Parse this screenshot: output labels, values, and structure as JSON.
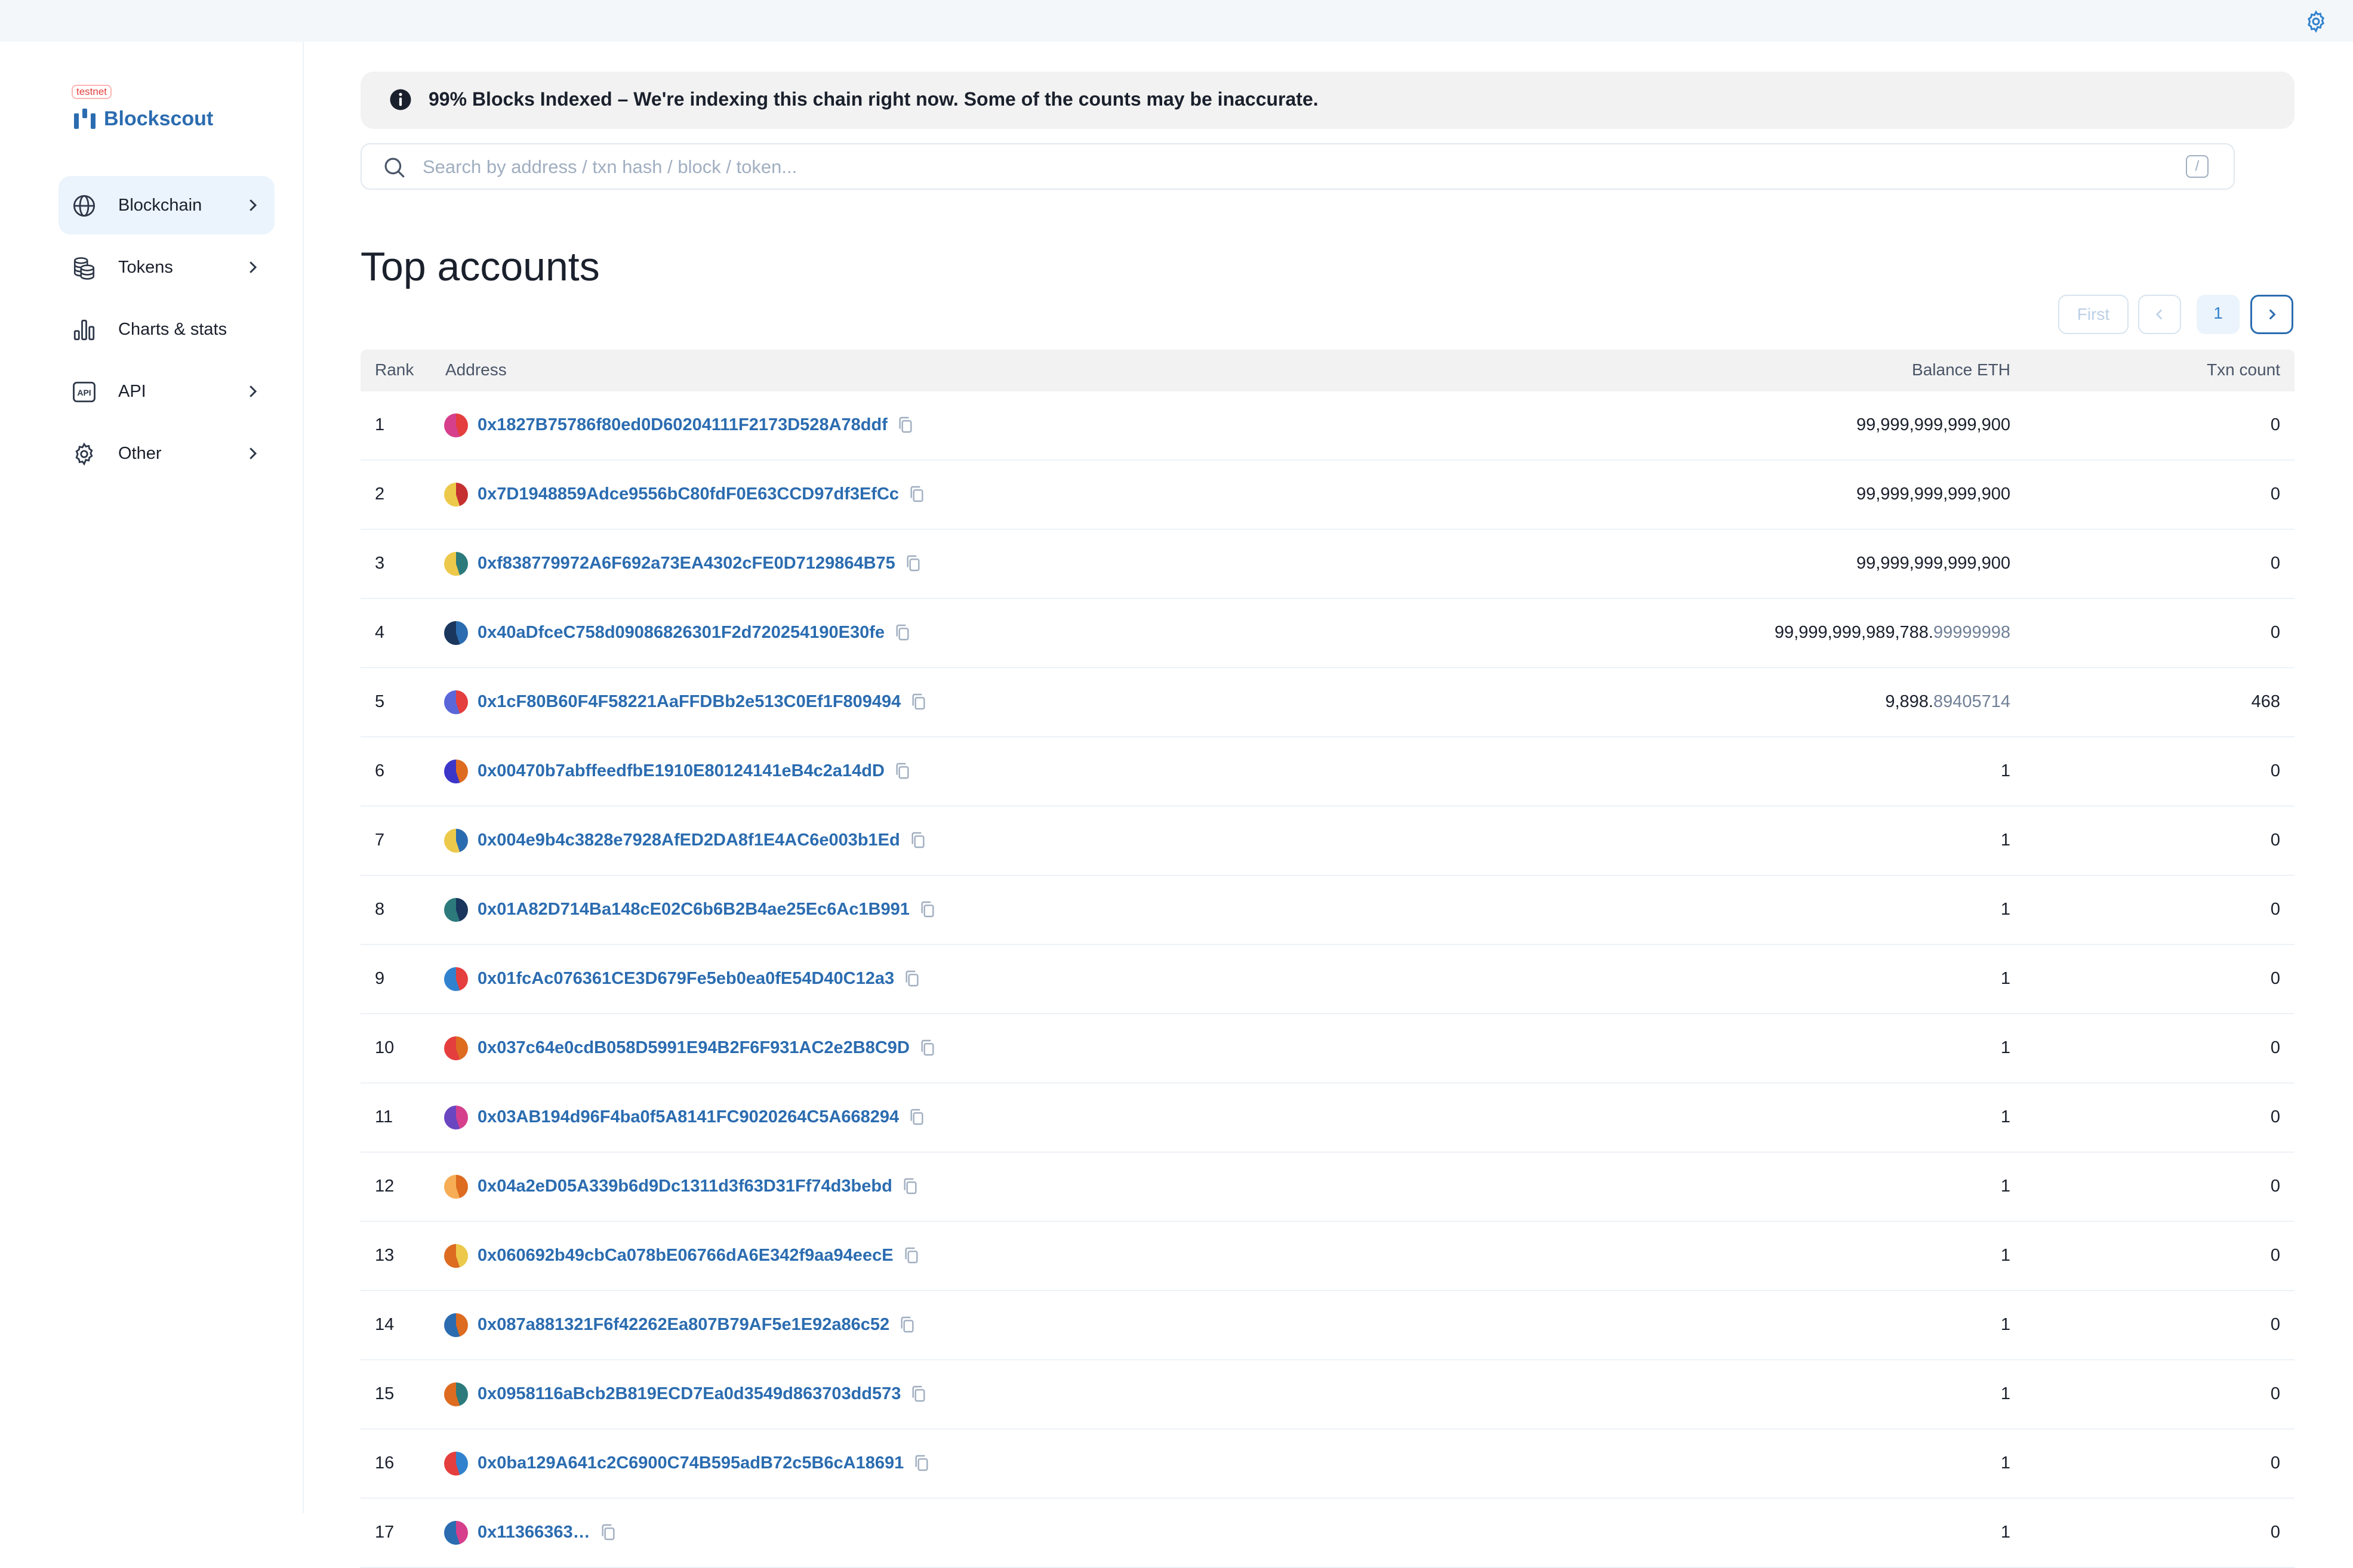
{
  "topbar": {
    "settings_icon": "gear-icon"
  },
  "sidebar": {
    "badge": "testnet",
    "brand": "Blockscout",
    "items": [
      {
        "label": "Blockchain",
        "icon": "globe-icon",
        "active": true,
        "has_submenu": true
      },
      {
        "label": "Tokens",
        "icon": "coins-icon",
        "active": false,
        "has_submenu": true
      },
      {
        "label": "Charts & stats",
        "icon": "bar-chart-icon",
        "active": false,
        "has_submenu": false
      },
      {
        "label": "API",
        "icon": "api-icon",
        "active": false,
        "has_submenu": true
      },
      {
        "label": "Other",
        "icon": "gear-icon",
        "active": false,
        "has_submenu": true
      }
    ]
  },
  "banner": {
    "icon": "info-icon",
    "text": "99% Blocks Indexed – We're indexing this chain right now. Some of the counts may be inaccurate."
  },
  "search": {
    "placeholder": "Search by address / txn hash / block / token...",
    "value": "",
    "shortcut": "/"
  },
  "page": {
    "title": "Top accounts"
  },
  "pagination": {
    "first": "First",
    "current": "1"
  },
  "table": {
    "columns": {
      "rank": "Rank",
      "address": "Address",
      "balance": "Balance ETH",
      "txn": "Txn count"
    },
    "rows": [
      {
        "rank": "1",
        "address": "0x1827B75786f80ed0D60204111F2173D528A78ddf",
        "balance_int": "99,999,999,999,900",
        "balance_frac": "",
        "txn": "0",
        "colors": [
          "#e53e3e",
          "#d53f8c"
        ]
      },
      {
        "rank": "2",
        "address": "0x7D1948859Adce9556bC80fdF0E63CCD97df3EfCc",
        "balance_int": "99,999,999,999,900",
        "balance_frac": "",
        "txn": "0",
        "colors": [
          "#c53030",
          "#ecc94b"
        ]
      },
      {
        "rank": "3",
        "address": "0xf838779972A6F692a73EA4302cFE0D7129864B75",
        "balance_int": "99,999,999,999,900",
        "balance_frac": "",
        "txn": "0",
        "colors": [
          "#2c7a7b",
          "#ecc94b"
        ]
      },
      {
        "rank": "4",
        "address": "0x40aDfceC758d09086826301F2d720254190E30fe",
        "balance_int": "99,999,999,989,788.",
        "balance_frac": "99999998",
        "txn": "0",
        "colors": [
          "#2b6cb0",
          "#1a365d"
        ]
      },
      {
        "rank": "5",
        "address": "0x1cF80B60F4F58221AaFFDBb2e513C0Ef1F809494",
        "balance_int": "9,898.",
        "balance_frac": "89405714",
        "txn": "468",
        "colors": [
          "#e53e3e",
          "#5a67d8"
        ]
      },
      {
        "rank": "6",
        "address": "0x00470b7abffeedfbE1910E80124141eB4c2a14dD",
        "balance_int": "1",
        "balance_frac": "",
        "txn": "0",
        "colors": [
          "#dd6b20",
          "#3c36c8"
        ]
      },
      {
        "rank": "7",
        "address": "0x004e9b4c3828e7928AfED2DA8f1E4AC6e003b1Ed",
        "balance_int": "1",
        "balance_frac": "",
        "txn": "0",
        "colors": [
          "#2b6cb0",
          "#ecc94b"
        ]
      },
      {
        "rank": "8",
        "address": "0x01A82D714Ba148cE02C6b6B2B4ae25Ec6Ac1B991",
        "balance_int": "1",
        "balance_frac": "",
        "txn": "0",
        "colors": [
          "#1a365d",
          "#2c7a7b"
        ]
      },
      {
        "rank": "9",
        "address": "0x01fcAc076361CE3D679Fe5eb0ea0fE54D40C12a3",
        "balance_int": "1",
        "balance_frac": "",
        "txn": "0",
        "colors": [
          "#e53e3e",
          "#3182ce"
        ]
      },
      {
        "rank": "10",
        "address": "0x037c64e0cdB058D5991E94B2F6F931AC2e2B8C9D",
        "balance_int": "1",
        "balance_frac": "",
        "txn": "0",
        "colors": [
          "#dd6b20",
          "#e53e3e"
        ]
      },
      {
        "rank": "11",
        "address": "0x03AB194d96F4ba0f5A8141FC9020264C5A668294",
        "balance_int": "1",
        "balance_frac": "",
        "txn": "0",
        "colors": [
          "#d53f8c",
          "#6b46c1"
        ]
      },
      {
        "rank": "12",
        "address": "0x04a2eD05A339b6d9Dc1311d3f63D31Ff74d3bebd",
        "balance_int": "1",
        "balance_frac": "",
        "txn": "0",
        "colors": [
          "#dd6b20",
          "#f6ad55"
        ]
      },
      {
        "rank": "13",
        "address": "0x060692b49cbCa078bE06766dA6E342f9aa94eecE",
        "balance_int": "1",
        "balance_frac": "",
        "txn": "0",
        "colors": [
          "#ecc94b",
          "#dd6b20"
        ]
      },
      {
        "rank": "14",
        "address": "0x087a881321F6f42262Ea807B79AF5e1E92a86c52",
        "balance_int": "1",
        "balance_frac": "",
        "txn": "0",
        "colors": [
          "#dd6b20",
          "#2b6cb0"
        ]
      },
      {
        "rank": "15",
        "address": "0x0958116aBcb2B819ECD7Ea0d3549d863703dd573",
        "balance_int": "1",
        "balance_frac": "",
        "txn": "0",
        "colors": [
          "#2c7a7b",
          "#dd6b20"
        ]
      },
      {
        "rank": "16",
        "address": "0x0ba129A641c2C6900C74B595adB72c5B6cA18691",
        "balance_int": "1",
        "balance_frac": "",
        "txn": "0",
        "colors": [
          "#3182ce",
          "#e53e3e"
        ]
      },
      {
        "rank": "17",
        "address": "0x11366363…",
        "balance_int": "1",
        "balance_frac": "",
        "txn": "0",
        "colors": [
          "#d53f8c",
          "#2b6cb0"
        ]
      }
    ]
  }
}
